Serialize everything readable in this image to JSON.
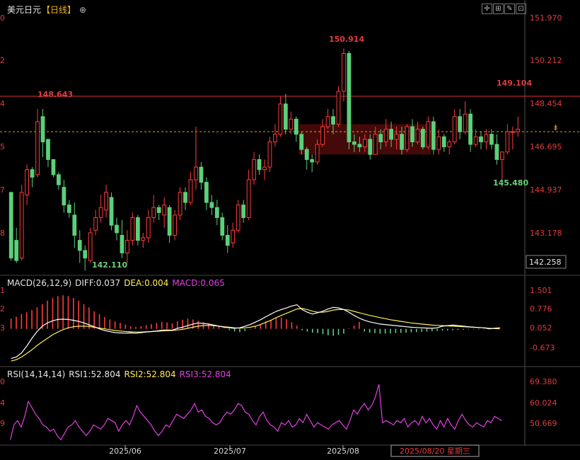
{
  "header": {
    "symbol": "美元日元",
    "period": "【日线】",
    "macd_label": "MACD(26,12,9)",
    "macd_diff": "DIFF:0.037",
    "macd_dea": "DEA:0.004",
    "macd_macd": "MACD:0.065",
    "rsi_label": "RSI(14,14,14)",
    "rsi1": "RSI1:52.804",
    "rsi2": "RSI2:52.804",
    "rsi3": "RSI3:52.804"
  },
  "colors": {
    "up": "#ff3b3b",
    "down": "#5ad07a",
    "diff": "#ffffff",
    "dea": "#ffee55",
    "rsi": "#e040e0",
    "hline": "#e03030",
    "price_line": "#e0a020",
    "axis_text": "#e03c3c"
  },
  "chart_data": [
    {
      "type": "candlestick",
      "x_axis_labels": [
        "2025/06",
        "2025/07",
        "2025/08",
        "2025/08/20 星期三"
      ],
      "y_ticks": [
        "151.970",
        "150.212",
        "148.454",
        "146.695",
        "144.937",
        "143.178",
        "142.258"
      ],
      "ylim": [
        142.1,
        152.3
      ],
      "left_clipped_ticks": [
        "0",
        "2",
        "4",
        "5",
        "7",
        "8"
      ],
      "annotations": [
        "148.643",
        "142.110",
        "150.914",
        "145.480",
        "149.104"
      ],
      "horizontal_line": 149.104,
      "current_price_line": 147.7,
      "range_box": {
        "x_start_index": 55,
        "x_end_index": 80,
        "y_top": 148.0,
        "y_bottom": 146.8
      },
      "candles": [
        {
          "o": 145.3,
          "h": 145.3,
          "l": 142.6,
          "c": 142.7
        },
        {
          "o": 143.4,
          "h": 143.9,
          "l": 142.5,
          "c": 142.6
        },
        {
          "o": 142.7,
          "h": 145.6,
          "l": 142.6,
          "c": 145.3
        },
        {
          "o": 145.2,
          "h": 146.4,
          "l": 144.8,
          "c": 146.2
        },
        {
          "o": 146.2,
          "h": 146.3,
          "l": 145.5,
          "c": 145.9
        },
        {
          "o": 146.0,
          "h": 148.6,
          "l": 145.9,
          "c": 148.1
        },
        {
          "o": 148.3,
          "h": 148.6,
          "l": 146.7,
          "c": 147.3
        },
        {
          "o": 147.4,
          "h": 147.4,
          "l": 146.3,
          "c": 146.6
        },
        {
          "o": 146.6,
          "h": 146.6,
          "l": 145.9,
          "c": 146.0
        },
        {
          "o": 146.0,
          "h": 146.1,
          "l": 145.4,
          "c": 145.6
        },
        {
          "o": 145.5,
          "h": 145.8,
          "l": 144.5,
          "c": 144.8
        },
        {
          "o": 144.8,
          "h": 145.0,
          "l": 144.3,
          "c": 144.5
        },
        {
          "o": 144.4,
          "h": 144.9,
          "l": 143.1,
          "c": 143.6
        },
        {
          "o": 143.4,
          "h": 143.8,
          "l": 142.5,
          "c": 143.0
        },
        {
          "o": 143.0,
          "h": 143.2,
          "l": 142.2,
          "c": 142.7
        },
        {
          "o": 142.6,
          "h": 143.9,
          "l": 142.5,
          "c": 143.7
        },
        {
          "o": 143.8,
          "h": 144.6,
          "l": 143.6,
          "c": 144.3
        },
        {
          "o": 144.3,
          "h": 145.2,
          "l": 144.1,
          "c": 144.7
        },
        {
          "o": 144.6,
          "h": 145.6,
          "l": 144.3,
          "c": 145.3
        },
        {
          "o": 145.1,
          "h": 145.3,
          "l": 143.8,
          "c": 144.0
        },
        {
          "o": 144.0,
          "h": 144.3,
          "l": 143.4,
          "c": 143.7
        },
        {
          "o": 143.6,
          "h": 144.2,
          "l": 142.7,
          "c": 142.9
        },
        {
          "o": 142.9,
          "h": 143.8,
          "l": 142.5,
          "c": 143.4
        },
        {
          "o": 143.4,
          "h": 144.5,
          "l": 143.2,
          "c": 144.3
        },
        {
          "o": 144.3,
          "h": 144.4,
          "l": 143.2,
          "c": 143.4
        },
        {
          "o": 143.4,
          "h": 143.7,
          "l": 143.1,
          "c": 143.5
        },
        {
          "o": 143.5,
          "h": 144.6,
          "l": 143.3,
          "c": 144.3
        },
        {
          "o": 144.3,
          "h": 145.2,
          "l": 144.1,
          "c": 144.7
        },
        {
          "o": 144.7,
          "h": 144.8,
          "l": 144.2,
          "c": 144.5
        },
        {
          "o": 144.4,
          "h": 145.1,
          "l": 143.9,
          "c": 144.8
        },
        {
          "o": 144.7,
          "h": 144.8,
          "l": 143.3,
          "c": 143.6
        },
        {
          "o": 143.6,
          "h": 144.6,
          "l": 143.4,
          "c": 144.4
        },
        {
          "o": 144.4,
          "h": 145.5,
          "l": 144.2,
          "c": 145.3
        },
        {
          "o": 145.3,
          "h": 145.5,
          "l": 144.6,
          "c": 144.9
        },
        {
          "o": 144.9,
          "h": 146.1,
          "l": 144.8,
          "c": 145.8
        },
        {
          "o": 145.8,
          "h": 147.9,
          "l": 145.4,
          "c": 146.3
        },
        {
          "o": 146.3,
          "h": 146.5,
          "l": 145.4,
          "c": 145.7
        },
        {
          "o": 145.7,
          "h": 145.9,
          "l": 144.6,
          "c": 144.9
        },
        {
          "o": 144.9,
          "h": 145.2,
          "l": 144.4,
          "c": 144.7
        },
        {
          "o": 144.7,
          "h": 145.0,
          "l": 144.0,
          "c": 144.3
        },
        {
          "o": 144.3,
          "h": 144.5,
          "l": 143.4,
          "c": 143.6
        },
        {
          "o": 143.6,
          "h": 144.0,
          "l": 142.9,
          "c": 143.2
        },
        {
          "o": 143.3,
          "h": 144.1,
          "l": 143.1,
          "c": 143.8
        },
        {
          "o": 143.8,
          "h": 145.0,
          "l": 143.7,
          "c": 144.8
        },
        {
          "o": 144.8,
          "h": 145.0,
          "l": 144.1,
          "c": 144.3
        },
        {
          "o": 144.3,
          "h": 146.2,
          "l": 144.2,
          "c": 145.8
        },
        {
          "o": 145.8,
          "h": 146.9,
          "l": 145.6,
          "c": 146.6
        },
        {
          "o": 146.6,
          "h": 146.8,
          "l": 146.0,
          "c": 146.2
        },
        {
          "o": 146.2,
          "h": 146.6,
          "l": 145.8,
          "c": 146.3
        },
        {
          "o": 146.3,
          "h": 147.5,
          "l": 146.1,
          "c": 147.3
        },
        {
          "o": 147.3,
          "h": 148.0,
          "l": 147.1,
          "c": 147.6
        },
        {
          "o": 147.6,
          "h": 149.1,
          "l": 147.5,
          "c": 148.8
        },
        {
          "o": 148.8,
          "h": 149.2,
          "l": 147.6,
          "c": 147.8
        },
        {
          "o": 147.8,
          "h": 148.5,
          "l": 147.6,
          "c": 148.2
        },
        {
          "o": 148.2,
          "h": 148.3,
          "l": 147.3,
          "c": 147.6
        },
        {
          "o": 147.6,
          "h": 147.7,
          "l": 146.8,
          "c": 147.0
        },
        {
          "o": 147.0,
          "h": 147.1,
          "l": 146.2,
          "c": 146.6
        },
        {
          "o": 146.6,
          "h": 146.8,
          "l": 146.1,
          "c": 146.5
        },
        {
          "o": 146.5,
          "h": 147.4,
          "l": 146.4,
          "c": 147.2
        },
        {
          "o": 147.2,
          "h": 148.2,
          "l": 147.1,
          "c": 147.9
        },
        {
          "o": 147.9,
          "h": 148.6,
          "l": 147.8,
          "c": 148.3
        },
        {
          "o": 148.3,
          "h": 148.6,
          "l": 147.6,
          "c": 148.0
        },
        {
          "o": 148.0,
          "h": 149.5,
          "l": 147.9,
          "c": 149.3
        },
        {
          "o": 149.3,
          "h": 151.0,
          "l": 148.9,
          "c": 150.8
        },
        {
          "o": 150.8,
          "h": 150.9,
          "l": 147.0,
          "c": 147.3
        },
        {
          "o": 147.3,
          "h": 147.6,
          "l": 146.9,
          "c": 147.2
        },
        {
          "o": 147.2,
          "h": 147.5,
          "l": 146.9,
          "c": 147.1
        },
        {
          "o": 147.1,
          "h": 147.6,
          "l": 146.9,
          "c": 147.4
        },
        {
          "o": 147.4,
          "h": 147.6,
          "l": 146.6,
          "c": 146.8
        },
        {
          "o": 146.8,
          "h": 147.9,
          "l": 146.8,
          "c": 147.6
        },
        {
          "o": 147.6,
          "h": 147.8,
          "l": 147.0,
          "c": 147.3
        },
        {
          "o": 147.3,
          "h": 148.2,
          "l": 147.1,
          "c": 147.8
        },
        {
          "o": 147.8,
          "h": 148.1,
          "l": 147.1,
          "c": 147.4
        },
        {
          "o": 147.4,
          "h": 147.9,
          "l": 147.0,
          "c": 147.6
        },
        {
          "o": 147.6,
          "h": 147.9,
          "l": 146.8,
          "c": 147.0
        },
        {
          "o": 147.0,
          "h": 148.0,
          "l": 146.9,
          "c": 147.9
        },
        {
          "o": 147.9,
          "h": 148.2,
          "l": 147.1,
          "c": 147.3
        },
        {
          "o": 147.3,
          "h": 148.1,
          "l": 147.2,
          "c": 147.8
        },
        {
          "o": 147.8,
          "h": 147.9,
          "l": 147.0,
          "c": 147.1
        },
        {
          "o": 147.1,
          "h": 148.3,
          "l": 147.0,
          "c": 148.1
        },
        {
          "o": 148.1,
          "h": 148.3,
          "l": 146.8,
          "c": 147.0
        },
        {
          "o": 147.0,
          "h": 147.8,
          "l": 146.8,
          "c": 147.5
        },
        {
          "o": 147.5,
          "h": 147.6,
          "l": 146.9,
          "c": 147.1
        },
        {
          "o": 147.1,
          "h": 147.4,
          "l": 146.8,
          "c": 147.3
        },
        {
          "o": 147.3,
          "h": 148.6,
          "l": 147.2,
          "c": 148.3
        },
        {
          "o": 148.3,
          "h": 148.6,
          "l": 147.4,
          "c": 147.7
        },
        {
          "o": 147.7,
          "h": 148.9,
          "l": 147.6,
          "c": 148.4
        },
        {
          "o": 148.4,
          "h": 148.6,
          "l": 146.9,
          "c": 147.2
        },
        {
          "o": 147.2,
          "h": 147.8,
          "l": 147.1,
          "c": 147.5
        },
        {
          "o": 147.5,
          "h": 147.7,
          "l": 147.0,
          "c": 147.3
        },
        {
          "o": 147.3,
          "h": 147.8,
          "l": 147.0,
          "c": 147.6
        },
        {
          "o": 147.6,
          "h": 147.8,
          "l": 147.0,
          "c": 147.2
        },
        {
          "o": 147.2,
          "h": 147.6,
          "l": 146.4,
          "c": 146.6
        },
        {
          "o": 146.6,
          "h": 146.9,
          "l": 145.5,
          "c": 146.9
        },
        {
          "o": 146.9,
          "h": 148.0,
          "l": 146.8,
          "c": 147.7
        },
        {
          "o": 147.7,
          "h": 147.9,
          "l": 147.0,
          "c": 147.7
        },
        {
          "o": 147.7,
          "h": 148.3,
          "l": 147.5,
          "c": 147.8
        }
      ]
    },
    {
      "type": "macd",
      "y_ticks": [
        "1.501",
        "0.776",
        "0.052",
        "-0.673"
      ],
      "ylim": [
        -1.3,
        1.6
      ],
      "left_clipped_ticks": [
        "1",
        "2",
        "3"
      ],
      "histogram": [
        0.38,
        0.45,
        0.55,
        0.62,
        0.7,
        0.8,
        0.92,
        1.05,
        1.15,
        1.22,
        1.25,
        1.22,
        1.15,
        1.05,
        0.92,
        0.8,
        0.65,
        0.55,
        0.44,
        0.35,
        0.28,
        0.22,
        0.16,
        0.1,
        0.07,
        0.1,
        0.14,
        0.18,
        0.22,
        0.26,
        0.24,
        0.2,
        0.28,
        0.34,
        0.38,
        0.35,
        0.3,
        0.25,
        0.2,
        0.14,
        0.08,
        0.02,
        -0.05,
        -0.1,
        -0.12,
        -0.08,
        -0.02,
        0.1,
        0.18,
        0.28,
        0.34,
        0.4,
        0.42,
        0.36,
        0.25,
        0.12,
        -0.05,
        -0.1,
        -0.14,
        -0.16,
        -0.2,
        -0.24,
        -0.26,
        -0.22,
        -0.18,
        0.02,
        0.12,
        0.26,
        -0.1,
        -0.14,
        -0.16,
        -0.18,
        -0.18,
        -0.17,
        -0.16,
        -0.15,
        -0.14,
        -0.13,
        -0.12,
        -0.11,
        -0.1,
        -0.09,
        -0.08,
        -0.07,
        -0.06,
        -0.05,
        -0.04,
        -0.03,
        -0.02,
        -0.02,
        -0.02,
        -0.02,
        0.02,
        0.04,
        0.06
      ],
      "diff": [
        -1.1,
        -1.05,
        -0.9,
        -0.65,
        -0.35,
        -0.1,
        0.1,
        0.22,
        0.3,
        0.35,
        0.36,
        0.35,
        0.32,
        0.28,
        0.22,
        0.15,
        0.08,
        0.0,
        -0.06,
        -0.1,
        -0.14,
        -0.15,
        -0.16,
        -0.15,
        -0.16,
        -0.14,
        -0.12,
        -0.1,
        -0.08,
        -0.05,
        -0.04,
        -0.05,
        0.02,
        0.06,
        0.12,
        0.18,
        0.22,
        0.2,
        0.18,
        0.14,
        0.1,
        0.06,
        0.04,
        0.02,
        0.04,
        0.1,
        0.16,
        0.25,
        0.34,
        0.45,
        0.55,
        0.65,
        0.72,
        0.78,
        0.85,
        0.9,
        0.72,
        0.62,
        0.55,
        0.6,
        0.66,
        0.74,
        0.8,
        0.78,
        0.72,
        0.62,
        0.5,
        0.4,
        0.32,
        0.26,
        0.22,
        0.18,
        0.16,
        0.14,
        0.12,
        0.1,
        0.08,
        0.06,
        0.05,
        0.04,
        0.03,
        0.02,
        0.04,
        0.1,
        0.12,
        0.14,
        0.12,
        0.1,
        0.08,
        0.06,
        0.05,
        0.04,
        0.0,
        0.02,
        0.04
      ],
      "dea": [
        -1.2,
        -1.15,
        -1.05,
        -0.92,
        -0.78,
        -0.62,
        -0.48,
        -0.35,
        -0.22,
        -0.12,
        -0.03,
        0.04,
        0.08,
        0.1,
        0.1,
        0.09,
        0.06,
        0.03,
        0.0,
        -0.03,
        -0.06,
        -0.08,
        -0.1,
        -0.11,
        -0.12,
        -0.12,
        -0.11,
        -0.1,
        -0.09,
        -0.08,
        -0.07,
        -0.06,
        -0.04,
        -0.02,
        0.02,
        0.06,
        0.1,
        0.12,
        0.13,
        0.12,
        0.1,
        0.08,
        0.06,
        0.04,
        0.03,
        0.04,
        0.06,
        0.1,
        0.16,
        0.24,
        0.32,
        0.42,
        0.5,
        0.58,
        0.66,
        0.74,
        0.76,
        0.72,
        0.66,
        0.62,
        0.62,
        0.65,
        0.7,
        0.72,
        0.72,
        0.7,
        0.65,
        0.6,
        0.55,
        0.5,
        0.46,
        0.42,
        0.38,
        0.34,
        0.31,
        0.28,
        0.25,
        0.22,
        0.2,
        0.18,
        0.16,
        0.14,
        0.13,
        0.12,
        0.11,
        0.1,
        0.09,
        0.08,
        0.07,
        0.06,
        0.05,
        0.04,
        0.02,
        0.01,
        0.0
      ]
    },
    {
      "type": "line",
      "name": "RSI",
      "y_ticks": [
        "69.380",
        "60.024",
        "50.669"
      ],
      "ylim": [
        41.5,
        72
      ],
      "left_clipped_ticks": [
        "0",
        "4",
        "9"
      ],
      "values": [
        43,
        50,
        52,
        49,
        54,
        61,
        58,
        55,
        53,
        50,
        49,
        47,
        48,
        45,
        43,
        46,
        49,
        50,
        52,
        49,
        47,
        45,
        47,
        50,
        49,
        48,
        50,
        53,
        52,
        51,
        47,
        50,
        52,
        50,
        54,
        59,
        56,
        54,
        52,
        50,
        47,
        45,
        47,
        50,
        49,
        52,
        55,
        54,
        53,
        55,
        57,
        60,
        56,
        57,
        54,
        53,
        51,
        50,
        51,
        54,
        56,
        55,
        57,
        60,
        59,
        56,
        55,
        52,
        50,
        54,
        56,
        52,
        50,
        49,
        47,
        51,
        50,
        52,
        49,
        50,
        53,
        51,
        55,
        52,
        49,
        51,
        50,
        49,
        48,
        50,
        51,
        52,
        50,
        48,
        52,
        57,
        55,
        58,
        60,
        57,
        59,
        63,
        69,
        51,
        52,
        51,
        50,
        52,
        51,
        53,
        49,
        51,
        52,
        50,
        54,
        51,
        53,
        50,
        48,
        52,
        49,
        53,
        50,
        48,
        52,
        55,
        52,
        50,
        49,
        51,
        50,
        49,
        52,
        51,
        54,
        53,
        52
      ]
    }
  ]
}
